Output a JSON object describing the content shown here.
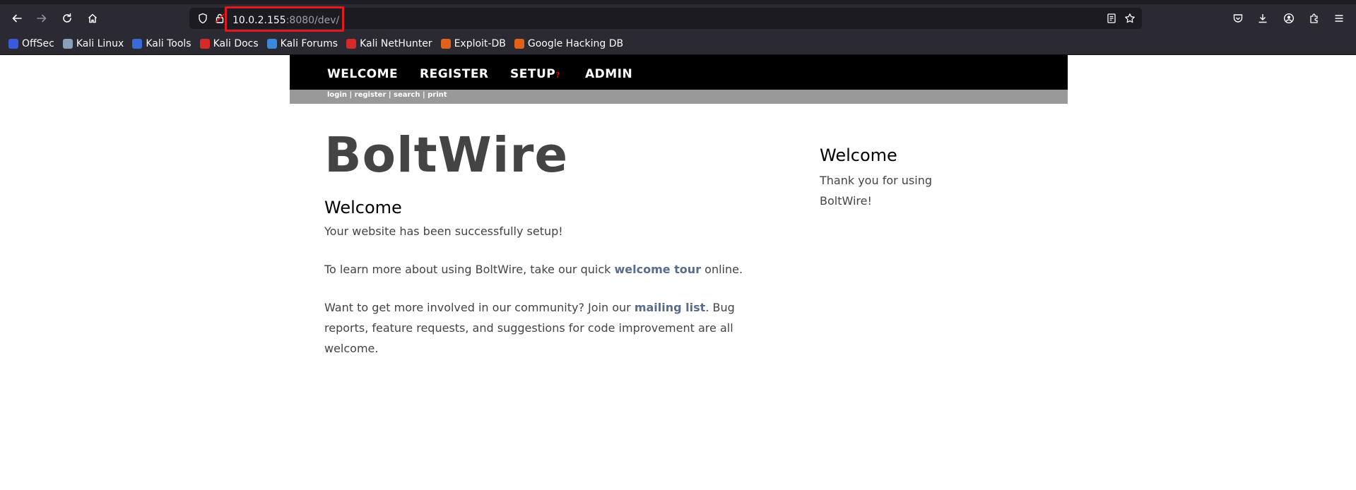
{
  "browser": {
    "url_host": "10.0.2.155",
    "url_rest": ":8080/dev/",
    "bookmarks": [
      {
        "label": "OffSec",
        "color": "#3a5bd9"
      },
      {
        "label": "Kali Linux",
        "color": "#8aa0b8"
      },
      {
        "label": "Kali Tools",
        "color": "#3a6ad9"
      },
      {
        "label": "Kali Docs",
        "color": "#d42a2a"
      },
      {
        "label": "Kali Forums",
        "color": "#3a8ad9"
      },
      {
        "label": "Kali NetHunter",
        "color": "#d42a2a"
      },
      {
        "label": "Exploit-DB",
        "color": "#e0621c"
      },
      {
        "label": "Google Hacking DB",
        "color": "#e0621c"
      }
    ]
  },
  "site": {
    "nav": [
      "WELCOME",
      "REGISTER",
      "SETUP",
      "ADMIN"
    ],
    "setup_mark": "?",
    "subnav": [
      "login",
      "register",
      "search",
      "print"
    ],
    "subnav_sep": " | ",
    "title": "BoltWire",
    "main": {
      "heading": "Welcome",
      "p1": "Your website has been successfully setup!",
      "p2_pre": "To learn more about using BoltWire, take our quick ",
      "p2_link": "welcome tour",
      "p2_post": " online.",
      "p3_pre": "Want to get more involved in our community? Join our ",
      "p3_link": "mailing list",
      "p3_post": ". Bug reports, feature requests, and suggestions for code improvement are all welcome."
    },
    "sidebar": {
      "heading": "Welcome",
      "text": "Thank you for using BoltWire!"
    }
  }
}
